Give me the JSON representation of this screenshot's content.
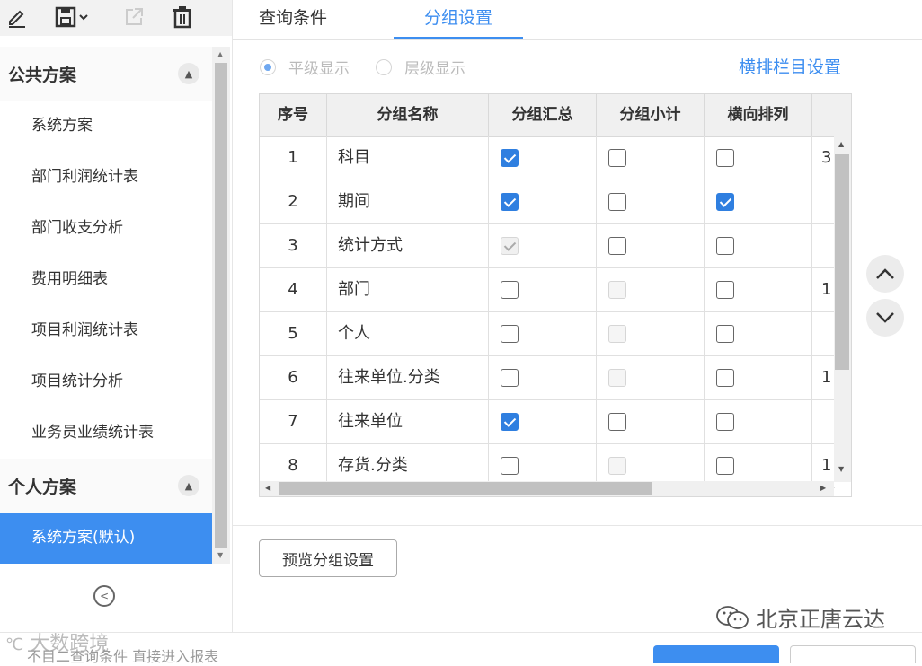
{
  "toolbar": {
    "icons": [
      "edit-icon",
      "save-icon",
      "export-icon",
      "delete-icon"
    ]
  },
  "sidebar": {
    "groups": [
      {
        "title": "公共方案",
        "items": [
          "系统方案",
          "部门利润统计表",
          "部门收支分析",
          "费用明细表",
          "项目利润统计表",
          "项目统计分析",
          "业务员业绩统计表"
        ]
      },
      {
        "title": "个人方案",
        "items": [
          "系统方案(默认)"
        ]
      }
    ],
    "active_item": "系统方案(默认)"
  },
  "tabs": {
    "query": "查询条件",
    "group": "分组设置",
    "active": "分组设置"
  },
  "display_mode": {
    "flat": "平级显示",
    "level": "层级显示",
    "selected": "平级显示"
  },
  "column_settings_link": "横排栏目设置",
  "grid": {
    "headers": [
      "序号",
      "分组名称",
      "分组汇总",
      "分组小计",
      "横向排列",
      ""
    ],
    "rows": [
      {
        "no": "1",
        "name": "科目",
        "sum": true,
        "sum_disabled": false,
        "subtotal": false,
        "subtotal_disabled": false,
        "horizontal": false,
        "extra": "3"
      },
      {
        "no": "2",
        "name": "期间",
        "sum": true,
        "sum_disabled": false,
        "subtotal": false,
        "subtotal_disabled": false,
        "horizontal": true,
        "extra": ""
      },
      {
        "no": "3",
        "name": "统计方式",
        "sum": true,
        "sum_disabled": true,
        "subtotal": false,
        "subtotal_disabled": false,
        "horizontal": false,
        "extra": ""
      },
      {
        "no": "4",
        "name": "部门",
        "sum": false,
        "sum_disabled": false,
        "subtotal": false,
        "subtotal_disabled": true,
        "horizontal": false,
        "extra": "1"
      },
      {
        "no": "5",
        "name": "个人",
        "sum": false,
        "sum_disabled": false,
        "subtotal": false,
        "subtotal_disabled": true,
        "horizontal": false,
        "extra": ""
      },
      {
        "no": "6",
        "name": "往来单位.分类",
        "sum": false,
        "sum_disabled": false,
        "subtotal": false,
        "subtotal_disabled": true,
        "horizontal": false,
        "extra": "1"
      },
      {
        "no": "7",
        "name": "往来单位",
        "sum": true,
        "sum_disabled": false,
        "subtotal": false,
        "subtotal_disabled": false,
        "horizontal": false,
        "extra": ""
      },
      {
        "no": "8",
        "name": "存货.分类",
        "sum": false,
        "sum_disabled": false,
        "subtotal": false,
        "subtotal_disabled": true,
        "horizontal": false,
        "extra": "1"
      }
    ]
  },
  "move_up_icon": "chevron-up-icon",
  "move_down_icon": "chevron-down-icon",
  "preview_button": "预览分组设置",
  "watermark_right": "北京正唐云达",
  "watermark_left": "大数跨境",
  "bottom_hint": "不目二查询条件 直接进入报表"
}
